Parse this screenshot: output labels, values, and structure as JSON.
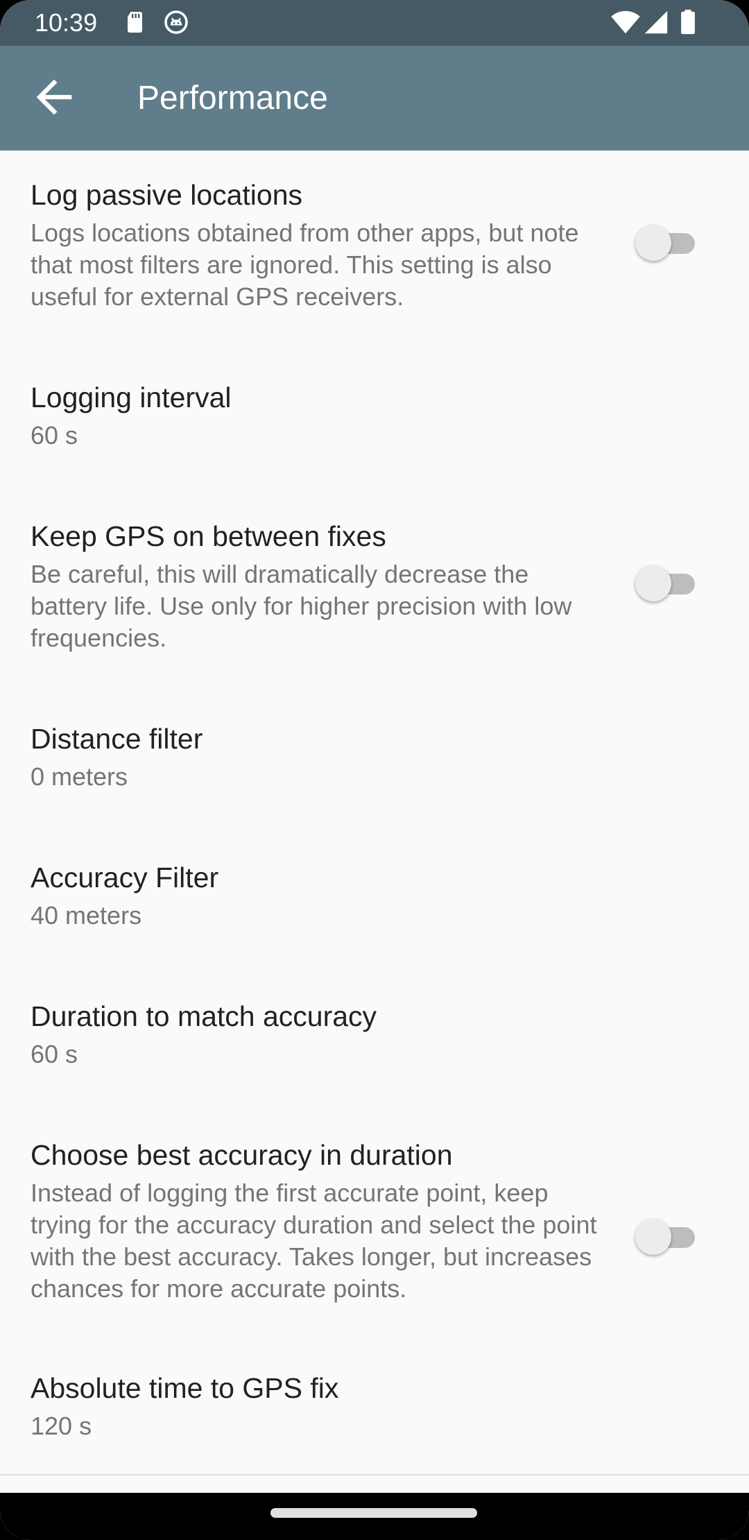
{
  "status_bar": {
    "time": "10:39",
    "left_icons": [
      "sd-card-icon",
      "github-cat-icon"
    ],
    "right_icons": [
      "wifi-icon",
      "signal-icon",
      "battery-icon"
    ]
  },
  "app_bar": {
    "title": "Performance",
    "back_icon": "arrow-back-icon",
    "color": "#607d8b",
    "status_color": "#455a64"
  },
  "preferences": [
    {
      "title": "Log passive locations",
      "summary": "Logs locations obtained from other apps, but note that most filters are ignored. This setting is also useful for external GPS receivers.",
      "switch": false
    },
    {
      "title": "Logging interval",
      "summary": "60 s"
    },
    {
      "title": "Keep GPS on between fixes",
      "summary": "Be careful, this will dramatically decrease the battery life. Use only for higher precision with low frequencies.",
      "switch": false
    },
    {
      "title": "Distance filter",
      "summary": "0 meters"
    },
    {
      "title": "Accuracy Filter",
      "summary": "40 meters"
    },
    {
      "title": "Duration to match accuracy",
      "summary": "60 s"
    },
    {
      "title": "Choose best accuracy in duration",
      "summary": "Instead of logging the first accurate point, keep trying for the accuracy duration and select the point with the best accuracy. Takes longer, but increases chances for more accurate points.",
      "switch": false
    },
    {
      "title": "Absolute time to GPS fix",
      "summary": "120 s"
    }
  ]
}
